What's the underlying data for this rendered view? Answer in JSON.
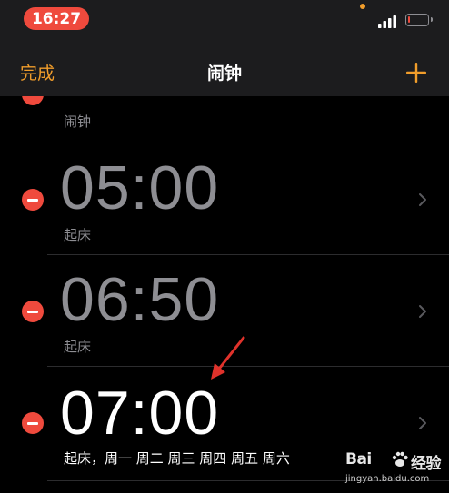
{
  "status_bar": {
    "time": "16:27",
    "battery": 0.1
  },
  "nav": {
    "done_label": "完成",
    "title": "闹钟",
    "add_icon": "plus-icon"
  },
  "alarms": [
    {
      "time": "",
      "label": "闹钟",
      "enabled": false
    },
    {
      "time": "05:00",
      "label": "起床",
      "enabled": false
    },
    {
      "time": "06:50",
      "label": "起床",
      "enabled": false
    },
    {
      "time": "07:00",
      "label": "起床，周一 周二 周三 周四 周五 周六",
      "enabled": true
    }
  ],
  "watermark": {
    "brand_left": "Bai",
    "brand_right": "经验",
    "url": "jingyan.baidu.com"
  },
  "colors": {
    "accent": "#f19d2b",
    "delete": "#ef4a3d",
    "inactive_text": "#8e8e93",
    "bar_bg": "#1c1c1e"
  }
}
